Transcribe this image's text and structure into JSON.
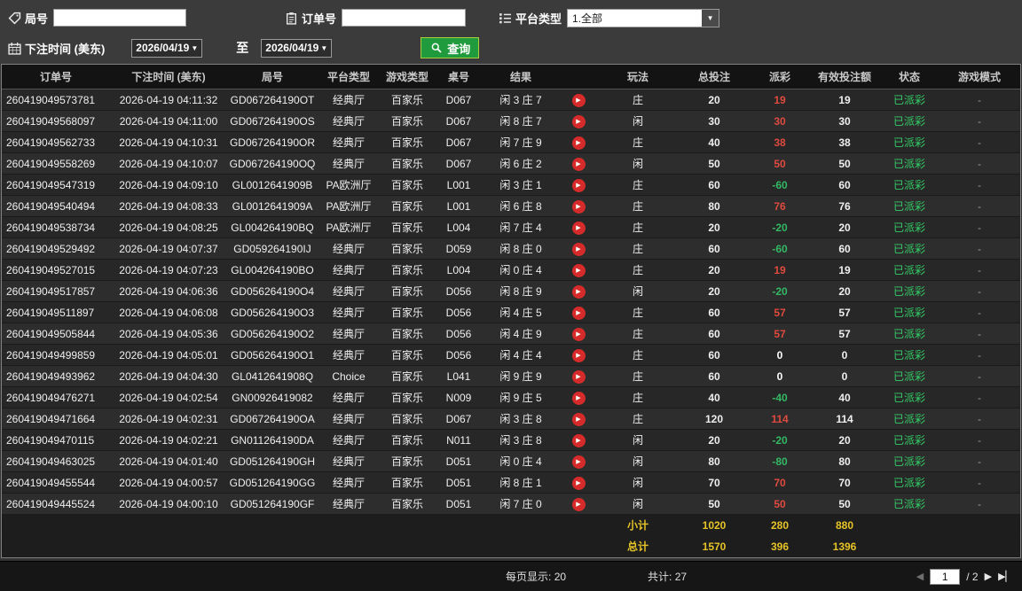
{
  "colors": {
    "payout_positive": "#df4a3e",
    "payout_negative": "#33b864",
    "payout_zero": "#ffffff",
    "status_paid": "#33cc66",
    "summary_value": "#e6c428",
    "play_button": "#d52b2b"
  },
  "toolbar": {
    "round_label": "局号",
    "round_input_value": "",
    "order_label": "订单号",
    "order_input_value": "",
    "platform_label": "平台类型",
    "platform_value": "1.全部",
    "bettime_label": "下注时间 (美东)",
    "date_from": "2026/04/19",
    "to_label": "至",
    "date_to": "2026/04/19",
    "search_label": "查询"
  },
  "icons": {
    "dropdown": "▼",
    "play": "▶",
    "prev": "◀",
    "next": "▶",
    "last": "▶▏"
  },
  "table": {
    "headers": [
      "订单号",
      "下注时间 (美东)",
      "局号",
      "平台类型",
      "游戏类型",
      "桌号",
      "结果",
      "",
      "玩法",
      "总投注",
      "派彩",
      "有效投注额",
      "状态",
      "游戏模式"
    ],
    "rows": [
      {
        "order": "260419049573781",
        "time": "2026-04-19 04:11:32",
        "round": "GD067264190OT",
        "platform": "经典厅",
        "game": "百家乐",
        "table": "D067",
        "result": "闲 3 庄 7",
        "side": "庄",
        "bet": 20,
        "payout": 19,
        "valid": 19,
        "status": "已派彩",
        "mode": "-"
      },
      {
        "order": "260419049568097",
        "time": "2026-04-19 04:11:00",
        "round": "GD067264190OS",
        "platform": "经典厅",
        "game": "百家乐",
        "table": "D067",
        "result": "闲 8 庄 7",
        "side": "闲",
        "bet": 30,
        "payout": 30,
        "valid": 30,
        "status": "已派彩",
        "mode": "-"
      },
      {
        "order": "260419049562733",
        "time": "2026-04-19 04:10:31",
        "round": "GD067264190OR",
        "platform": "经典厅",
        "game": "百家乐",
        "table": "D067",
        "result": "闲 7 庄 9",
        "side": "庄",
        "bet": 40,
        "payout": 38,
        "valid": 38,
        "status": "已派彩",
        "mode": "-"
      },
      {
        "order": "260419049558269",
        "time": "2026-04-19 04:10:07",
        "round": "GD067264190OQ",
        "platform": "经典厅",
        "game": "百家乐",
        "table": "D067",
        "result": "闲 6 庄 2",
        "side": "闲",
        "bet": 50,
        "payout": 50,
        "valid": 50,
        "status": "已派彩",
        "mode": "-"
      },
      {
        "order": "260419049547319",
        "time": "2026-04-19 04:09:10",
        "round": "GL0012641909B",
        "platform": "PA欧洲厅",
        "game": "百家乐",
        "table": "L001",
        "result": "闲 3 庄 1",
        "side": "庄",
        "bet": 60,
        "payout": -60,
        "valid": 60,
        "status": "已派彩",
        "mode": "-"
      },
      {
        "order": "260419049540494",
        "time": "2026-04-19 04:08:33",
        "round": "GL0012641909A",
        "platform": "PA欧洲厅",
        "game": "百家乐",
        "table": "L001",
        "result": "闲 6 庄 8",
        "side": "庄",
        "bet": 80,
        "payout": 76,
        "valid": 76,
        "status": "已派彩",
        "mode": "-"
      },
      {
        "order": "260419049538734",
        "time": "2026-04-19 04:08:25",
        "round": "GL004264190BQ",
        "platform": "PA欧洲厅",
        "game": "百家乐",
        "table": "L004",
        "result": "闲 7 庄 4",
        "side": "庄",
        "bet": 20,
        "payout": -20,
        "valid": 20,
        "status": "已派彩",
        "mode": "-"
      },
      {
        "order": "260419049529492",
        "time": "2026-04-19 04:07:37",
        "round": "GD059264190IJ",
        "platform": "经典厅",
        "game": "百家乐",
        "table": "D059",
        "result": "闲 8 庄 0",
        "side": "庄",
        "bet": 60,
        "payout": -60,
        "valid": 60,
        "status": "已派彩",
        "mode": "-"
      },
      {
        "order": "260419049527015",
        "time": "2026-04-19 04:07:23",
        "round": "GL004264190BO",
        "platform": "经典厅",
        "game": "百家乐",
        "table": "L004",
        "result": "闲 0 庄 4",
        "side": "庄",
        "bet": 20,
        "payout": 19,
        "valid": 19,
        "status": "已派彩",
        "mode": "-"
      },
      {
        "order": "260419049517857",
        "time": "2026-04-19 04:06:36",
        "round": "GD056264190O4",
        "platform": "经典厅",
        "game": "百家乐",
        "table": "D056",
        "result": "闲 8 庄 9",
        "side": "闲",
        "bet": 20,
        "payout": -20,
        "valid": 20,
        "status": "已派彩",
        "mode": "-"
      },
      {
        "order": "260419049511897",
        "time": "2026-04-19 04:06:08",
        "round": "GD056264190O3",
        "platform": "经典厅",
        "game": "百家乐",
        "table": "D056",
        "result": "闲 4 庄 5",
        "side": "庄",
        "bet": 60,
        "payout": 57,
        "valid": 57,
        "status": "已派彩",
        "mode": "-"
      },
      {
        "order": "260419049505844",
        "time": "2026-04-19 04:05:36",
        "round": "GD056264190O2",
        "platform": "经典厅",
        "game": "百家乐",
        "table": "D056",
        "result": "闲 4 庄 9",
        "side": "庄",
        "bet": 60,
        "payout": 57,
        "valid": 57,
        "status": "已派彩",
        "mode": "-"
      },
      {
        "order": "260419049499859",
        "time": "2026-04-19 04:05:01",
        "round": "GD056264190O1",
        "platform": "经典厅",
        "game": "百家乐",
        "table": "D056",
        "result": "闲 4 庄 4",
        "side": "庄",
        "bet": 60,
        "payout": 0,
        "valid": 0,
        "status": "已派彩",
        "mode": "-"
      },
      {
        "order": "260419049493962",
        "time": "2026-04-19 04:04:30",
        "round": "GL0412641908Q",
        "platform": "Choice",
        "game": "百家乐",
        "table": "L041",
        "result": "闲 9 庄 9",
        "side": "庄",
        "bet": 60,
        "payout": 0,
        "valid": 0,
        "status": "已派彩",
        "mode": "-"
      },
      {
        "order": "260419049476271",
        "time": "2026-04-19 04:02:54",
        "round": "GN00926419082",
        "platform": "经典厅",
        "game": "百家乐",
        "table": "N009",
        "result": "闲 9 庄 5",
        "side": "庄",
        "bet": 40,
        "payout": -40,
        "valid": 40,
        "status": "已派彩",
        "mode": "-"
      },
      {
        "order": "260419049471664",
        "time": "2026-04-19 04:02:31",
        "round": "GD067264190OA",
        "platform": "经典厅",
        "game": "百家乐",
        "table": "D067",
        "result": "闲 3 庄 8",
        "side": "庄",
        "bet": 120,
        "payout": 114,
        "valid": 114,
        "status": "已派彩",
        "mode": "-"
      },
      {
        "order": "260419049470115",
        "time": "2026-04-19 04:02:21",
        "round": "GN011264190DA",
        "platform": "经典厅",
        "game": "百家乐",
        "table": "N011",
        "result": "闲 3 庄 8",
        "side": "闲",
        "bet": 20,
        "payout": -20,
        "valid": 20,
        "status": "已派彩",
        "mode": "-"
      },
      {
        "order": "260419049463025",
        "time": "2026-04-19 04:01:40",
        "round": "GD051264190GH",
        "platform": "经典厅",
        "game": "百家乐",
        "table": "D051",
        "result": "闲 0 庄 4",
        "side": "闲",
        "bet": 80,
        "payout": -80,
        "valid": 80,
        "status": "已派彩",
        "mode": "-"
      },
      {
        "order": "260419049455544",
        "time": "2026-04-19 04:00:57",
        "round": "GD051264190GG",
        "platform": "经典厅",
        "game": "百家乐",
        "table": "D051",
        "result": "闲 8 庄 1",
        "side": "闲",
        "bet": 70,
        "payout": 70,
        "valid": 70,
        "status": "已派彩",
        "mode": "-"
      },
      {
        "order": "260419049445524",
        "time": "2026-04-19 04:00:10",
        "round": "GD051264190GF",
        "platform": "经典厅",
        "game": "百家乐",
        "table": "D051",
        "result": "闲 7 庄 0",
        "side": "闲",
        "bet": 50,
        "payout": 50,
        "valid": 50,
        "status": "已派彩",
        "mode": "-"
      }
    ],
    "subtotal": {
      "label": "小计",
      "total_bet": "1020",
      "payout": "280",
      "valid": "880"
    },
    "total": {
      "label": "总计",
      "total_bet": "1570",
      "payout": "396",
      "valid": "1396"
    }
  },
  "footer": {
    "per_page_label": "每页显示:",
    "per_page_value": "20",
    "total_count_label": "共计:",
    "total_count_value": "27",
    "page": "1",
    "page_separator": "/",
    "page_total": "2"
  }
}
